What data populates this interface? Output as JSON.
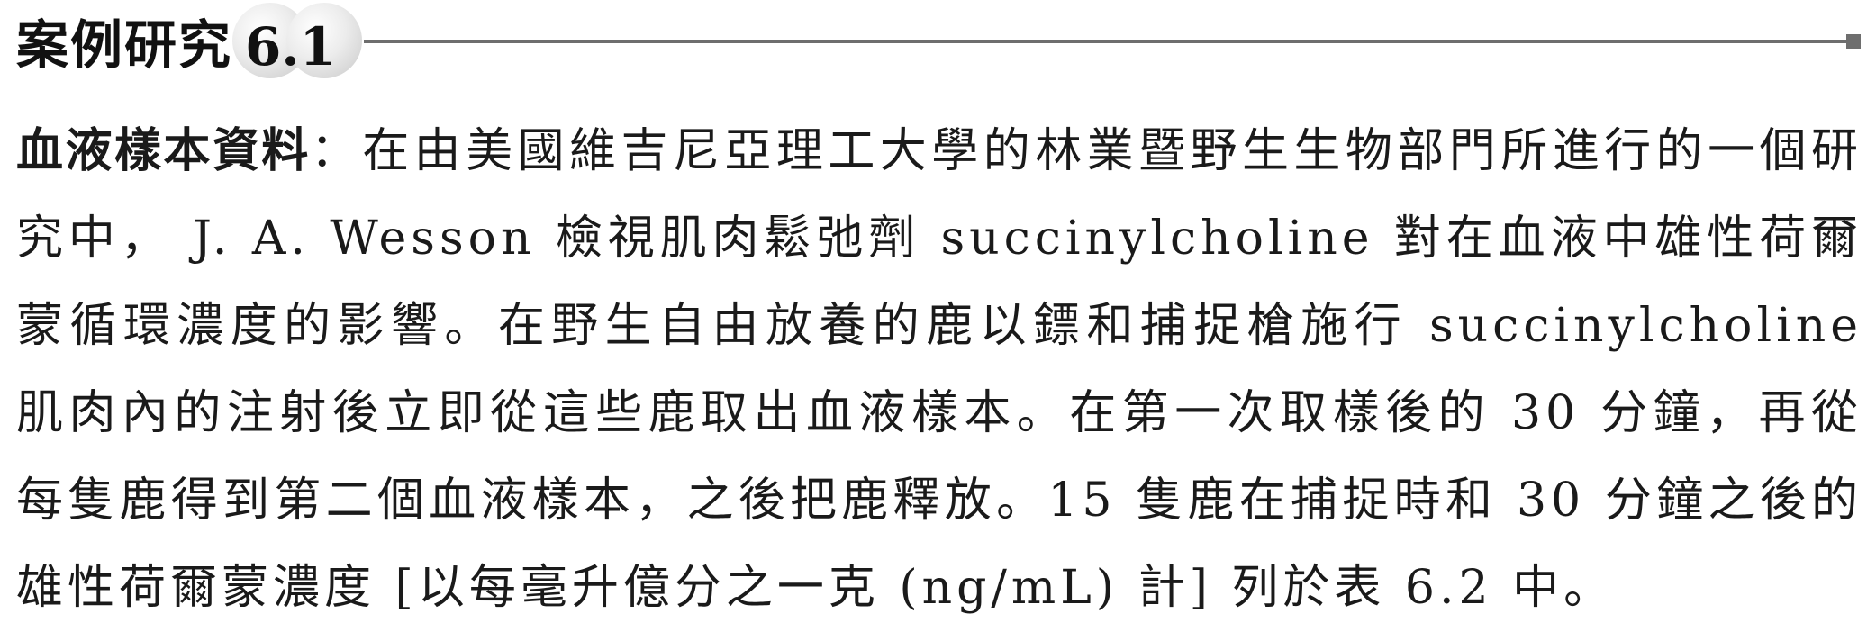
{
  "header": {
    "title": "案例研究",
    "number": "6.1"
  },
  "body": {
    "lead": "血液樣本資料",
    "separator": "：",
    "text": "在由美國維吉尼亞理工大學的林業暨野生生物部門所進行的一個研究中， J. A. Wesson 檢視肌肉鬆弛劑 succinylcholine 對在血液中雄性荷爾蒙循環濃度的影響。在野生自由放養的鹿以鏢和捕捉槍施行 succinylcholine 肌肉內的注射後立即從這些鹿取出血液樣本。在第一次取樣後的 30 分鐘，再從每隻鹿得到第二個血液樣本，之後把鹿釋放。15 隻鹿在捕捉時和 30 分鐘之後的雄性荷爾蒙濃度 [以每毫升億分之一克 (ng/mL) 計] 列於表 6.2 中。"
  },
  "colors": {
    "rule": "#6e6e6e",
    "text": "#1a1a1a"
  }
}
